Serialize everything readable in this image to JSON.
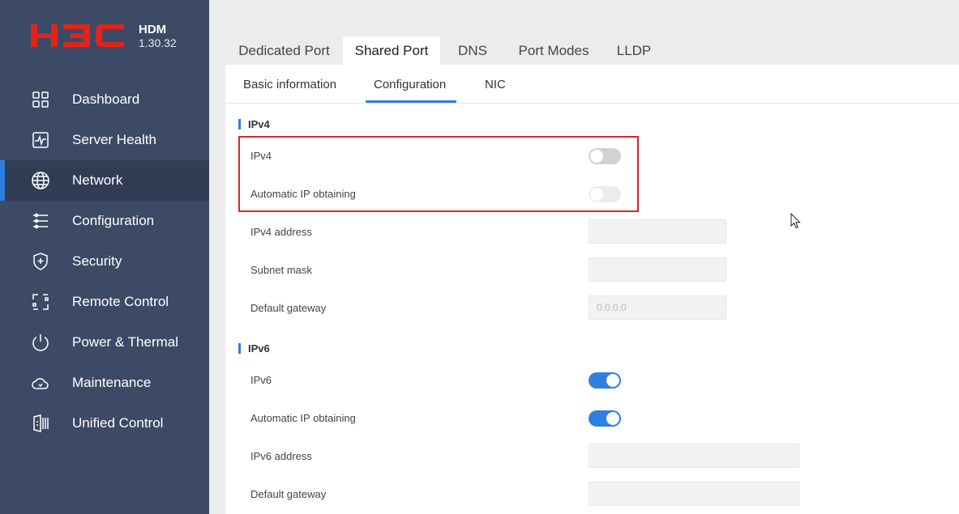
{
  "brand": {
    "logo_text": "H3C",
    "product_name": "HDM",
    "version": "1.30.32"
  },
  "sidebar": {
    "items": [
      {
        "label": "Dashboard",
        "icon": "dashboard-icon",
        "active": false
      },
      {
        "label": "Server Health",
        "icon": "server-health-icon",
        "active": false
      },
      {
        "label": "Network",
        "icon": "globe-icon",
        "active": true
      },
      {
        "label": "Configuration",
        "icon": "configuration-icon",
        "active": false
      },
      {
        "label": "Security",
        "icon": "shield-plus-icon",
        "active": false
      },
      {
        "label": "Remote Control",
        "icon": "remote-control-icon",
        "active": false
      },
      {
        "label": "Power & Thermal",
        "icon": "power-icon",
        "active": false
      },
      {
        "label": "Maintenance",
        "icon": "maintenance-cloud-icon",
        "active": false
      },
      {
        "label": "Unified Control",
        "icon": "unified-control-icon",
        "active": false
      }
    ]
  },
  "tabs": [
    {
      "label": "Dedicated Port",
      "active": false
    },
    {
      "label": "Shared Port",
      "active": true
    },
    {
      "label": "DNS",
      "active": false
    },
    {
      "label": "Port Modes",
      "active": false
    },
    {
      "label": "LLDP",
      "active": false
    }
  ],
  "subtabs": [
    {
      "label": "Basic information",
      "active": false
    },
    {
      "label": "Configuration",
      "active": true
    },
    {
      "label": "NIC",
      "active": false
    }
  ],
  "ipv4": {
    "section_title": "IPv4",
    "enable_label": "IPv4",
    "enable_state": "off",
    "auto_ip_label": "Automatic IP obtaining",
    "auto_ip_state": "off-disabled",
    "address_label": "IPv4 address",
    "address_value": "",
    "subnet_label": "Subnet mask",
    "subnet_value": "",
    "gateway_label": "Default gateway",
    "gateway_placeholder": "0.0.0.0"
  },
  "ipv6": {
    "section_title": "IPv6",
    "enable_label": "IPv6",
    "enable_state": "on",
    "auto_ip_label": "Automatic IP obtaining",
    "auto_ip_state": "on",
    "address_label": "IPv6 address",
    "address_value": "",
    "gateway_label": "Default gateway",
    "gateway_value": ""
  },
  "colors": {
    "sidebar_bg": "#3d4a66",
    "accent": "#2f7fe0",
    "logo_red": "#e2231a",
    "highlight_red": "#d9242e"
  }
}
